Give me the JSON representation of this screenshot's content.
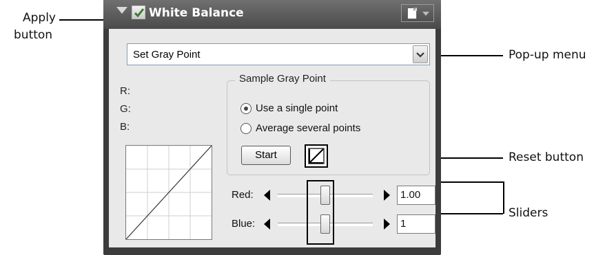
{
  "callouts": {
    "apply_line1": "Apply",
    "apply_line2": "button",
    "popup_menu": "Pop-up menu",
    "reset_button": "Reset button",
    "sliders": "Sliders"
  },
  "panel": {
    "title": "White Balance",
    "apply_checked": true,
    "mode_select": {
      "value": "Set Gray Point"
    },
    "readouts": {
      "r": "R:",
      "g": "G:",
      "b": "B:"
    },
    "sample_group": {
      "legend": "Sample Gray Point",
      "options": [
        {
          "label": "Use a single point",
          "selected": true
        },
        {
          "label": "Average several points",
          "selected": false
        }
      ],
      "start_label": "Start"
    },
    "sliders": [
      {
        "label": "Red:",
        "value": "1.00"
      },
      {
        "label": "Blue:",
        "value": "1"
      }
    ]
  },
  "colors": {
    "panel_frame": "#3c3c3c",
    "titlebar_text": "#ffffff",
    "body_bg": "#e9e9e9"
  }
}
